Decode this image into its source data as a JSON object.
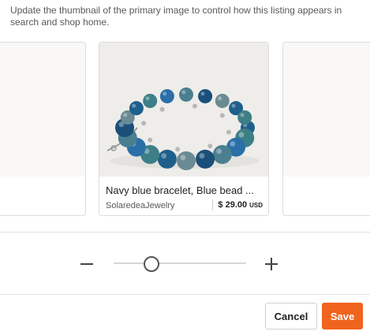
{
  "instructions": "Update the thumbnail of the primary image to control how this listing appears in search and shop home.",
  "listing": {
    "title": "Navy blue bracelet, Blue bead ...",
    "shop": "SolaredeaJewelry",
    "price": "$ 29.00",
    "currency": "USD"
  },
  "zoom": {
    "level": 0.28
  },
  "actions": {
    "cancel": "Cancel",
    "save": "Save"
  },
  "colors": {
    "accent": "#f1641e",
    "bead_blue": "#1f5f8b",
    "bead_teal": "#3d7f86"
  }
}
